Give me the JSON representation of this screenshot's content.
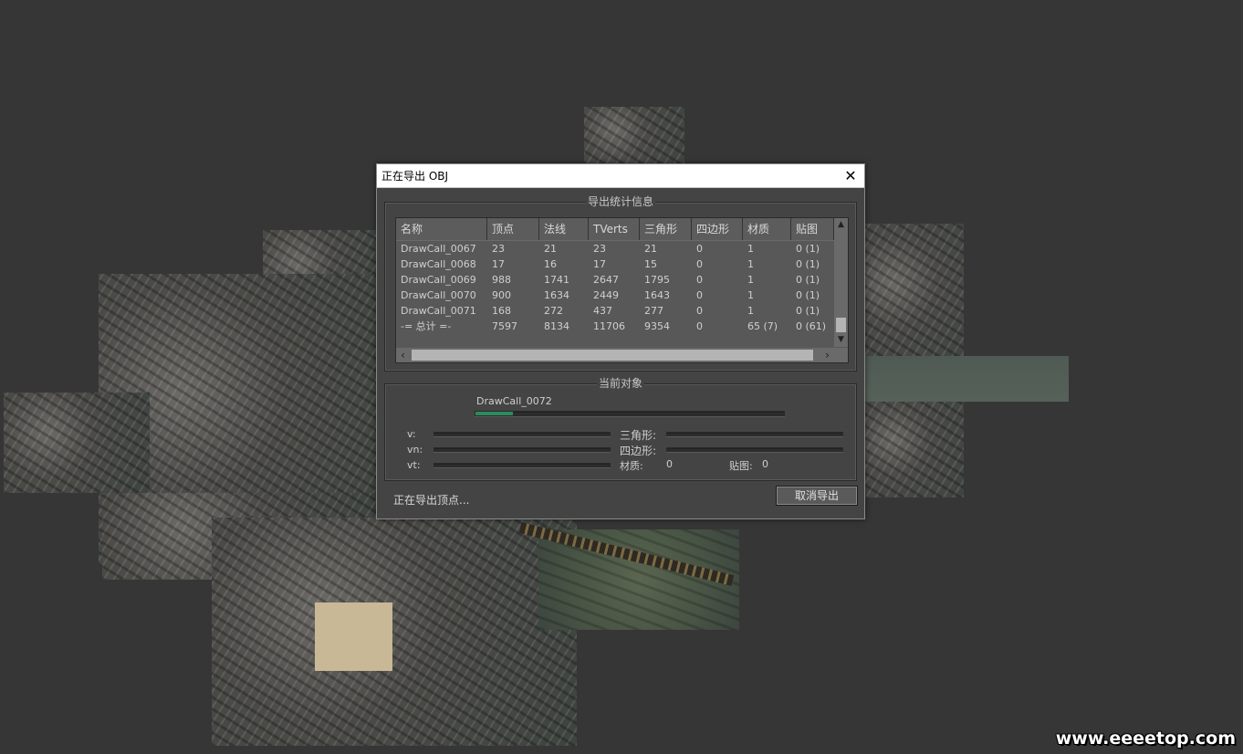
{
  "dialog": {
    "title": "正在导出 OBJ",
    "close_glyph": "✕",
    "stats_group_label": "导出统计信息",
    "columns": [
      "名称",
      "顶点",
      "法线",
      "TVerts",
      "三角形",
      "四边形",
      "材质",
      "贴图"
    ],
    "rows": [
      [
        "DrawCall_0067",
        "23",
        "21",
        "23",
        "21",
        "0",
        "1",
        "0 (1)"
      ],
      [
        "DrawCall_0068",
        "17",
        "16",
        "17",
        "15",
        "0",
        "1",
        "0 (1)"
      ],
      [
        "DrawCall_0069",
        "988",
        "1741",
        "2647",
        "1795",
        "0",
        "1",
        "0 (1)"
      ],
      [
        "DrawCall_0070",
        "900",
        "1634",
        "2449",
        "1643",
        "0",
        "1",
        "0 (1)"
      ],
      [
        "DrawCall_0071",
        "168",
        "272",
        "437",
        "277",
        "0",
        "1",
        "0 (1)"
      ],
      [
        "-= 总计 =-",
        "7597",
        "8134",
        "11706",
        "9354",
        "0",
        "65 (7)",
        "0 (61)"
      ]
    ],
    "current_group_label": "当前对象",
    "current_object": "DrawCall_0072",
    "current_progress": 0.12,
    "v_label": "v:",
    "vn_label": "vn:",
    "vt_label": "vt:",
    "tri_label": "三角形:",
    "quad_label": "四边形:",
    "material_label": "材质:",
    "material_value": "0",
    "texture_label": "贴图:",
    "texture_value": "0",
    "status_text": "正在导出顶点...",
    "cancel_label": "取消导出",
    "progress_color": "#2e8a5e"
  },
  "watermark": "www.eeeetop.com"
}
